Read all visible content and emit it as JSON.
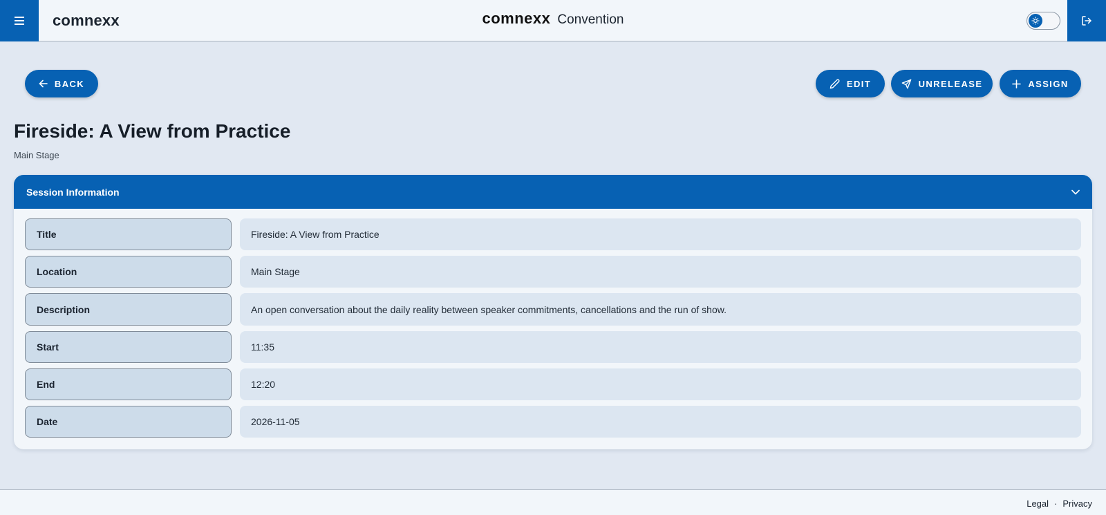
{
  "header": {
    "brand": "comnexx",
    "logo_text": "comnexx",
    "app_name": "Convention",
    "icons": {
      "menu": "hamburger-menu-icon",
      "logout": "logout-icon",
      "theme": "sun-icon"
    }
  },
  "actions": {
    "back_label": "BACK",
    "edit_label": "EDIT",
    "unrelease_label": "UNRELEASE",
    "assign_label": "ASSIGN"
  },
  "page": {
    "title": "Fireside: A View from Practice",
    "subtitle": "Main Stage"
  },
  "session_card": {
    "header": "Session Information",
    "rows": [
      {
        "label": "Title",
        "value": "Fireside: A View from Practice"
      },
      {
        "label": "Location",
        "value": "Main Stage"
      },
      {
        "label": "Description",
        "value": "An open conversation about the daily reality between speaker commitments, cancellations and the run of show."
      },
      {
        "label": "Start",
        "value": "11:35"
      },
      {
        "label": "End",
        "value": "12:20"
      },
      {
        "label": "Date",
        "value": "2026-11-05"
      }
    ]
  },
  "footer": {
    "legal": "Legal",
    "separator": "·",
    "privacy": "Privacy"
  },
  "colors": {
    "primary": "#0761b3",
    "background": "#e1e8f2",
    "surface": "#f2f6fa",
    "label_bg": "#cddcea",
    "value_bg": "#dce6f1"
  }
}
